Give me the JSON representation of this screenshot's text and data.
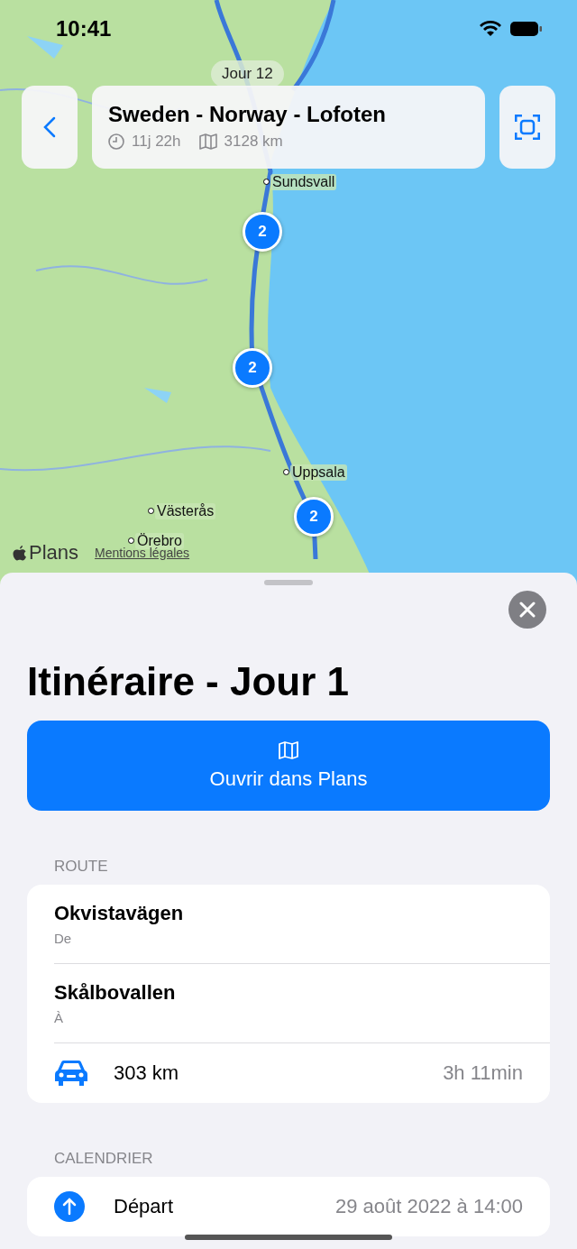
{
  "status_bar": {
    "time": "10:41"
  },
  "map": {
    "day_label": "Jour 12",
    "places": [
      "Sundsvall",
      "Uppsala",
      "Västerås",
      "Örebro"
    ],
    "clusters": [
      "2",
      "2",
      "2"
    ],
    "brand": "Plans",
    "legal_link": "Mentions légales"
  },
  "trip": {
    "title": "Sweden - Norway - Lofoten",
    "duration": "11j 22h",
    "distance": "3128 km"
  },
  "sheet": {
    "title": "Itinéraire - Jour 1",
    "open_button": "Ouvrir dans Plans",
    "route": {
      "header": "ROUTE",
      "stops": [
        {
          "name": "Okvistavägen",
          "caption": "De"
        },
        {
          "name": "Skålbovallen",
          "caption": "À"
        }
      ],
      "distance": "303 km",
      "duration": "3h 11min"
    },
    "calendar": {
      "header": "CALENDRIER",
      "events": [
        {
          "label": "Départ",
          "date": "29 août 2022 à 14:00"
        }
      ]
    }
  }
}
